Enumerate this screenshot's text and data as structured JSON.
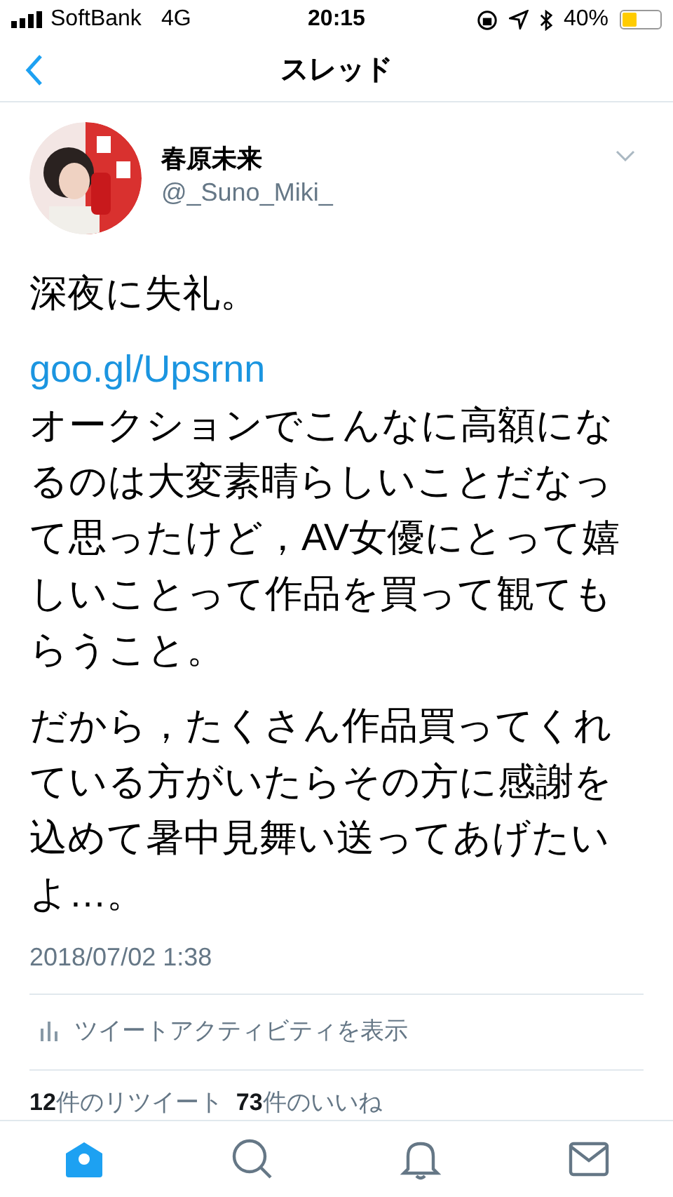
{
  "status_bar": {
    "carrier": "SoftBank",
    "network": "4G",
    "time": "20:15",
    "battery": "40%"
  },
  "nav": {
    "title": "スレッド"
  },
  "author": {
    "name": "春原未来",
    "handle": "@_Suno_Miki_"
  },
  "tweet": {
    "paragraphs": [
      {
        "kind": "text",
        "text": "深夜に失礼。"
      },
      {
        "kind": "link",
        "text": "goo.gl/Upsrnn",
        "after": "オークションでこんなに高額になるのは大変素晴らしいことだなって思ったけど，AV女優にとって嬉しいことって作品を買って観てもらうこと。"
      },
      {
        "kind": "text",
        "text": "だから，たくさん作品買ってくれている方がいたらその方に感謝を込めて暑中見舞い送ってあげたいよ…。"
      }
    ],
    "timestamp": "2018/07/02 1:38",
    "activity": "ツイートアクティビティを表示",
    "stats": "**12**件のリツイート  **73**件のいいね"
  },
  "tab_bar": [
    {
      "kind": "home",
      "selected": true
    },
    {
      "kind": "search",
      "selected": false
    },
    {
      "kind": "bell",
      "selected": false
    },
    {
      "kind": "mail",
      "selected": false
    }
  ]
}
